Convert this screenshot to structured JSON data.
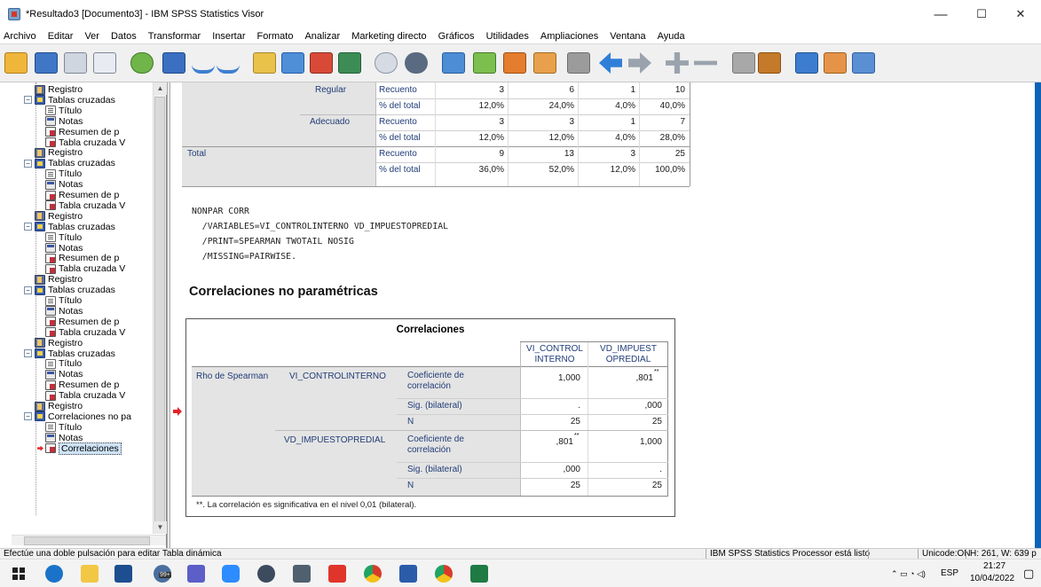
{
  "window": {
    "title": "*Resultado3 [Documento3] - IBM SPSS Statistics Visor",
    "minimize": "—",
    "maximize": "☐",
    "close": "✕"
  },
  "menu": [
    "Archivo",
    "Editar",
    "Ver",
    "Datos",
    "Transformar",
    "Insertar",
    "Formato",
    "Analizar",
    "Marketing directo",
    "Gráficos",
    "Utilidades",
    "Ampliaciones",
    "Ventana",
    "Ayuda"
  ],
  "toolbar": {
    "icons": [
      "open-icon",
      "save-icon",
      "print-icon",
      "print-preview-icon",
      "export-icon",
      "recall-dialog-icon",
      "undo-icon",
      "redo-icon",
      "goto-data-icon",
      "goto-case-icon",
      "goto-variable-icon",
      "variables-icon",
      "sphere-icon",
      "scale-icon",
      "insert-icon",
      "select-icon",
      "edit-icon",
      "designate-window-icon",
      "square-icon",
      "back-arrow-icon",
      "forward-arrow-icon",
      "expand-icon",
      "collapse-icon",
      "show-icon",
      "hide-icon",
      "insert-heading-icon",
      "insert-title-icon",
      "insert-text-icon"
    ]
  },
  "outline": {
    "items": [
      {
        "label": "Registro",
        "type": "book"
      },
      {
        "label": "Tablas cruzadas",
        "type": "cross"
      },
      {
        "label": "Título",
        "type": "doc"
      },
      {
        "label": "Notas",
        "type": "notes"
      },
      {
        "label": "Resumen de p",
        "type": "tbl"
      },
      {
        "label": "Tabla cruzada V",
        "type": "tbl"
      },
      {
        "label": "Registro",
        "type": "book"
      },
      {
        "label": "Tablas cruzadas",
        "type": "cross"
      },
      {
        "label": "Título",
        "type": "doc"
      },
      {
        "label": "Notas",
        "type": "notes"
      },
      {
        "label": "Resumen de p",
        "type": "tbl"
      },
      {
        "label": "Tabla cruzada V",
        "type": "tbl"
      },
      {
        "label": "Registro",
        "type": "book"
      },
      {
        "label": "Tablas cruzadas",
        "type": "cross"
      },
      {
        "label": "Título",
        "type": "doc"
      },
      {
        "label": "Notas",
        "type": "notes"
      },
      {
        "label": "Resumen de p",
        "type": "tbl"
      },
      {
        "label": "Tabla cruzada V",
        "type": "tbl"
      },
      {
        "label": "Registro",
        "type": "book"
      },
      {
        "label": "Tablas cruzadas",
        "type": "cross"
      },
      {
        "label": "Título",
        "type": "doc"
      },
      {
        "label": "Notas",
        "type": "notes"
      },
      {
        "label": "Resumen de p",
        "type": "tbl"
      },
      {
        "label": "Tabla cruzada V",
        "type": "tbl"
      },
      {
        "label": "Registro",
        "type": "book"
      },
      {
        "label": "Tablas cruzadas",
        "type": "cross"
      },
      {
        "label": "Título",
        "type": "doc"
      },
      {
        "label": "Notas",
        "type": "notes"
      },
      {
        "label": "Resumen de p",
        "type": "tbl"
      },
      {
        "label": "Tabla cruzada V",
        "type": "tbl"
      },
      {
        "label": "Registro",
        "type": "book"
      },
      {
        "label": "Correlaciones no pa",
        "type": "cross"
      },
      {
        "label": "Título",
        "type": "doc"
      },
      {
        "label": "Notas",
        "type": "notes"
      },
      {
        "label": "Correlaciones",
        "type": "tbl"
      }
    ]
  },
  "crosstab": {
    "rows": [
      {
        "group": "Regular",
        "stat": "Recuento",
        "v": [
          "3",
          "6",
          "1",
          "10"
        ]
      },
      {
        "group": "",
        "stat": "% del total",
        "v": [
          "12,0%",
          "24,0%",
          "4,0%",
          "40,0%"
        ]
      },
      {
        "group": "Adecuado",
        "stat": "Recuento",
        "v": [
          "3",
          "3",
          "1",
          "7"
        ]
      },
      {
        "group": "",
        "stat": "% del total",
        "v": [
          "12,0%",
          "12,0%",
          "4,0%",
          "28,0%"
        ]
      },
      {
        "group": "Total",
        "stat": "Recuento",
        "v": [
          "9",
          "13",
          "3",
          "25"
        ]
      },
      {
        "group": "",
        "stat": "% del total",
        "v": [
          "36,0%",
          "52,0%",
          "12,0%",
          "100,0%"
        ]
      }
    ]
  },
  "syntax": [
    "NONPAR CORR",
    "  /VARIABLES=VI_CONTROLINTERNO VD_IMPUESTOPREDIAL",
    "  /PRINT=SPEARMAN TWOTAIL NOSIG",
    "  /MISSING=PAIRWISE."
  ],
  "section_heading": "Correlaciones no paramétricas",
  "corr": {
    "title": "Correlaciones",
    "col1a": "VI_CONTROL",
    "col1b": "INTERNO",
    "col2a": "VD_IMPUEST",
    "col2b": "OPREDIAL",
    "rho": "Rho de Spearman",
    "var1": "VI_CONTROLINTERNO",
    "var2": "VD_IMPUESTOPREDIAL",
    "coef_a": "Coeficiente de",
    "coef_b": "correlación",
    "sig": "Sig. (bilateral)",
    "n": "N",
    "r1": [
      "1,000",
      ",801"
    ],
    "r2": [
      ".",
      ",000"
    ],
    "r3": [
      "25",
      "25"
    ],
    "r4": [
      ",801",
      "1,000"
    ],
    "r5": [
      ",000",
      "."
    ],
    "r6": [
      "25",
      "25"
    ],
    "sup": "**",
    "footnote": "**. La correlación es significativa en el nivel 0,01 (bilateral)."
  },
  "status": {
    "left": "Efectúe una doble pulsación para editar Tabla dinámica",
    "processor": "IBM SPSS Statistics Processor está listo",
    "unicode": "Unicode:ON",
    "dims": "H: 261, W: 639 p"
  },
  "taskbar": {
    "badge": "99+",
    "lang": "ESP",
    "time": "21:27",
    "date": "10/04/2022"
  }
}
